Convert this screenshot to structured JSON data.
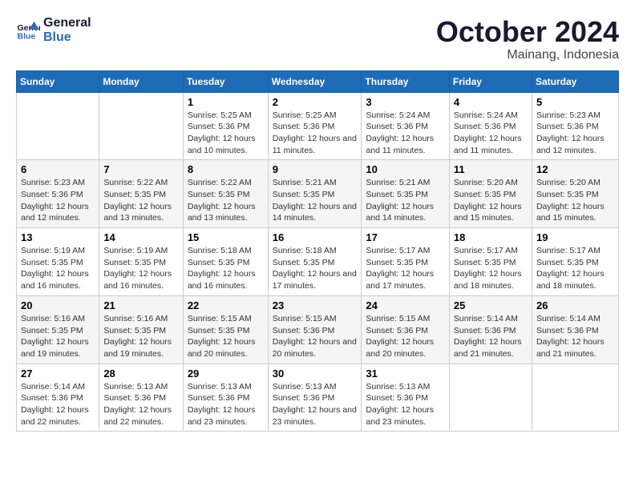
{
  "logo": {
    "line1": "General",
    "line2": "Blue"
  },
  "header": {
    "month": "October 2024",
    "location": "Mainang, Indonesia"
  },
  "days_of_week": [
    "Sunday",
    "Monday",
    "Tuesday",
    "Wednesday",
    "Thursday",
    "Friday",
    "Saturday"
  ],
  "weeks": [
    [
      null,
      null,
      {
        "num": "1",
        "sunrise": "Sunrise: 5:25 AM",
        "sunset": "Sunset: 5:36 PM",
        "daylight": "Daylight: 12 hours and 10 minutes."
      },
      {
        "num": "2",
        "sunrise": "Sunrise: 5:25 AM",
        "sunset": "Sunset: 5:36 PM",
        "daylight": "Daylight: 12 hours and 11 minutes."
      },
      {
        "num": "3",
        "sunrise": "Sunrise: 5:24 AM",
        "sunset": "Sunset: 5:36 PM",
        "daylight": "Daylight: 12 hours and 11 minutes."
      },
      {
        "num": "4",
        "sunrise": "Sunrise: 5:24 AM",
        "sunset": "Sunset: 5:36 PM",
        "daylight": "Daylight: 12 hours and 11 minutes."
      },
      {
        "num": "5",
        "sunrise": "Sunrise: 5:23 AM",
        "sunset": "Sunset: 5:36 PM",
        "daylight": "Daylight: 12 hours and 12 minutes."
      }
    ],
    [
      {
        "num": "6",
        "sunrise": "Sunrise: 5:23 AM",
        "sunset": "Sunset: 5:36 PM",
        "daylight": "Daylight: 12 hours and 12 minutes."
      },
      {
        "num": "7",
        "sunrise": "Sunrise: 5:22 AM",
        "sunset": "Sunset: 5:35 PM",
        "daylight": "Daylight: 12 hours and 13 minutes."
      },
      {
        "num": "8",
        "sunrise": "Sunrise: 5:22 AM",
        "sunset": "Sunset: 5:35 PM",
        "daylight": "Daylight: 12 hours and 13 minutes."
      },
      {
        "num": "9",
        "sunrise": "Sunrise: 5:21 AM",
        "sunset": "Sunset: 5:35 PM",
        "daylight": "Daylight: 12 hours and 14 minutes."
      },
      {
        "num": "10",
        "sunrise": "Sunrise: 5:21 AM",
        "sunset": "Sunset: 5:35 PM",
        "daylight": "Daylight: 12 hours and 14 minutes."
      },
      {
        "num": "11",
        "sunrise": "Sunrise: 5:20 AM",
        "sunset": "Sunset: 5:35 PM",
        "daylight": "Daylight: 12 hours and 15 minutes."
      },
      {
        "num": "12",
        "sunrise": "Sunrise: 5:20 AM",
        "sunset": "Sunset: 5:35 PM",
        "daylight": "Daylight: 12 hours and 15 minutes."
      }
    ],
    [
      {
        "num": "13",
        "sunrise": "Sunrise: 5:19 AM",
        "sunset": "Sunset: 5:35 PM",
        "daylight": "Daylight: 12 hours and 16 minutes."
      },
      {
        "num": "14",
        "sunrise": "Sunrise: 5:19 AM",
        "sunset": "Sunset: 5:35 PM",
        "daylight": "Daylight: 12 hours and 16 minutes."
      },
      {
        "num": "15",
        "sunrise": "Sunrise: 5:18 AM",
        "sunset": "Sunset: 5:35 PM",
        "daylight": "Daylight: 12 hours and 16 minutes."
      },
      {
        "num": "16",
        "sunrise": "Sunrise: 5:18 AM",
        "sunset": "Sunset: 5:35 PM",
        "daylight": "Daylight: 12 hours and 17 minutes."
      },
      {
        "num": "17",
        "sunrise": "Sunrise: 5:17 AM",
        "sunset": "Sunset: 5:35 PM",
        "daylight": "Daylight: 12 hours and 17 minutes."
      },
      {
        "num": "18",
        "sunrise": "Sunrise: 5:17 AM",
        "sunset": "Sunset: 5:35 PM",
        "daylight": "Daylight: 12 hours and 18 minutes."
      },
      {
        "num": "19",
        "sunrise": "Sunrise: 5:17 AM",
        "sunset": "Sunset: 5:35 PM",
        "daylight": "Daylight: 12 hours and 18 minutes."
      }
    ],
    [
      {
        "num": "20",
        "sunrise": "Sunrise: 5:16 AM",
        "sunset": "Sunset: 5:35 PM",
        "daylight": "Daylight: 12 hours and 19 minutes."
      },
      {
        "num": "21",
        "sunrise": "Sunrise: 5:16 AM",
        "sunset": "Sunset: 5:35 PM",
        "daylight": "Daylight: 12 hours and 19 minutes."
      },
      {
        "num": "22",
        "sunrise": "Sunrise: 5:15 AM",
        "sunset": "Sunset: 5:35 PM",
        "daylight": "Daylight: 12 hours and 20 minutes."
      },
      {
        "num": "23",
        "sunrise": "Sunrise: 5:15 AM",
        "sunset": "Sunset: 5:36 PM",
        "daylight": "Daylight: 12 hours and 20 minutes."
      },
      {
        "num": "24",
        "sunrise": "Sunrise: 5:15 AM",
        "sunset": "Sunset: 5:36 PM",
        "daylight": "Daylight: 12 hours and 20 minutes."
      },
      {
        "num": "25",
        "sunrise": "Sunrise: 5:14 AM",
        "sunset": "Sunset: 5:36 PM",
        "daylight": "Daylight: 12 hours and 21 minutes."
      },
      {
        "num": "26",
        "sunrise": "Sunrise: 5:14 AM",
        "sunset": "Sunset: 5:36 PM",
        "daylight": "Daylight: 12 hours and 21 minutes."
      }
    ],
    [
      {
        "num": "27",
        "sunrise": "Sunrise: 5:14 AM",
        "sunset": "Sunset: 5:36 PM",
        "daylight": "Daylight: 12 hours and 22 minutes."
      },
      {
        "num": "28",
        "sunrise": "Sunrise: 5:13 AM",
        "sunset": "Sunset: 5:36 PM",
        "daylight": "Daylight: 12 hours and 22 minutes."
      },
      {
        "num": "29",
        "sunrise": "Sunrise: 5:13 AM",
        "sunset": "Sunset: 5:36 PM",
        "daylight": "Daylight: 12 hours and 23 minutes."
      },
      {
        "num": "30",
        "sunrise": "Sunrise: 5:13 AM",
        "sunset": "Sunset: 5:36 PM",
        "daylight": "Daylight: 12 hours and 23 minutes."
      },
      {
        "num": "31",
        "sunrise": "Sunrise: 5:13 AM",
        "sunset": "Sunset: 5:36 PM",
        "daylight": "Daylight: 12 hours and 23 minutes."
      },
      null,
      null
    ]
  ]
}
